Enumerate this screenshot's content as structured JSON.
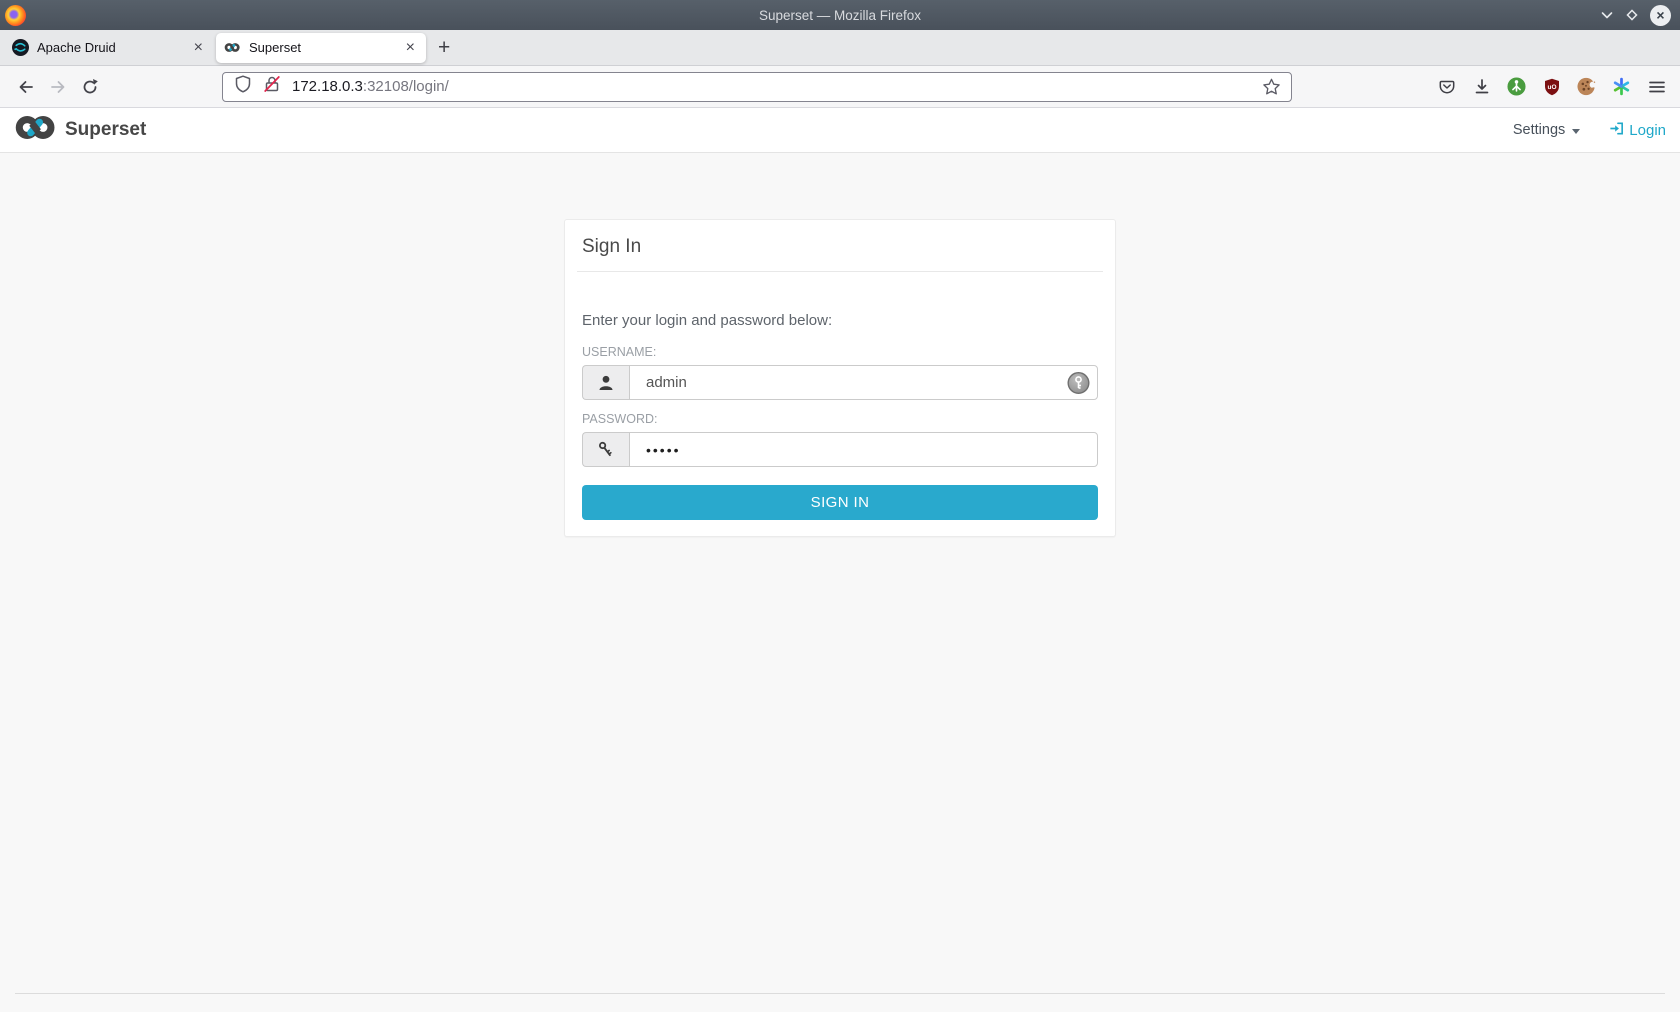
{
  "titlebar": {
    "title": "Superset — Mozilla Firefox"
  },
  "tabbar": {
    "tabs": [
      {
        "label": "Apache Druid",
        "close_glyph": "×"
      },
      {
        "label": "Superset",
        "close_glyph": "×"
      }
    ],
    "new_tab_glyph": "+"
  },
  "toolbar": {
    "url": {
      "host": "172.18.0.3",
      "path": ":32108/login/"
    }
  },
  "navbar": {
    "brand": "Superset",
    "settings": "Settings",
    "login": "Login"
  },
  "login": {
    "title": "Sign In",
    "instructions": "Enter your login and password below:",
    "username_label": "USERNAME:",
    "username_value": "admin",
    "password_label": "PASSWORD:",
    "password_masked": "•••••",
    "submit": "SIGN IN"
  },
  "window_controls": {
    "close_glyph": "×"
  },
  "colors": {
    "accent_teal": "#1fa8c9",
    "signin_button": "#29a9cd",
    "titlebar": "#4e565e",
    "insecure_slash": "#e2264d",
    "ublock_red": "#7c1012"
  }
}
